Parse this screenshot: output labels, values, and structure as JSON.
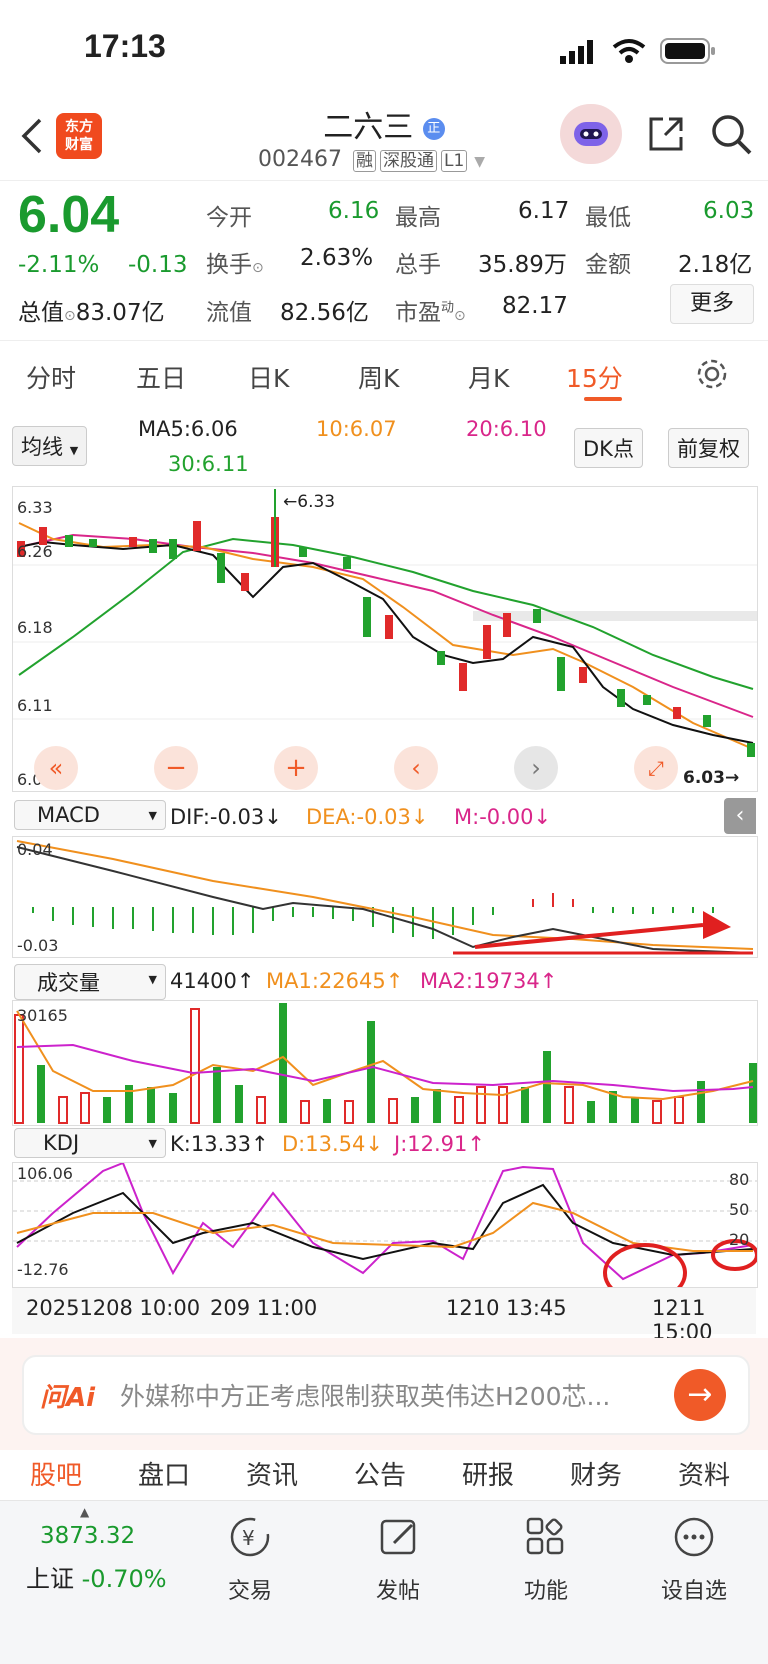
{
  "status": {
    "time": "17:13"
  },
  "header": {
    "logo_text": "东方\n财富",
    "name": "二六三",
    "code": "002467",
    "tags": [
      "融",
      "深股通",
      "L1"
    ]
  },
  "quote": {
    "price": "6.04",
    "pct": "-2.11%",
    "chg": "-0.13",
    "open_label": "今开",
    "open": "6.16",
    "high_label": "最高",
    "high": "6.17",
    "low_label": "最低",
    "low": "6.03",
    "turnover_label": "换手",
    "turnover": "2.63%",
    "vol_label": "总手",
    "vol": "35.89万",
    "amt_label": "金额",
    "amt": "2.18亿",
    "mcap_label": "总值",
    "mcap": "83.07亿",
    "float_label": "流值",
    "float": "82.56亿",
    "pe_label": "市盈",
    "pe_sup": "动",
    "pe": "82.17",
    "more": "更多"
  },
  "tabs": [
    "分时",
    "五日",
    "日K",
    "周K",
    "月K",
    "15分"
  ],
  "ma": {
    "selector": "均线",
    "ma5": "MA5:6.06",
    "ma10": "10:6.07",
    "ma20": "20:6.10",
    "ma30": "30:6.11",
    "dk": "DK点",
    "fq": "前复权"
  },
  "kline": {
    "y_top": "6.33",
    "y2": "6.26",
    "y3": "6.18",
    "y4": "6.11",
    "y_bot": "6.03",
    "hi_mark": "6.33",
    "lo_mark": "6.03"
  },
  "macd": {
    "selector": "MACD",
    "dif": "DIF:-0.03",
    "dea": "DEA:-0.03",
    "m": "M:-0.00",
    "y_top": "0.04",
    "y_bot": "-0.03"
  },
  "volume": {
    "selector": "成交量",
    "vol": "41400",
    "ma1": "MA1:22645",
    "ma2": "MA2:19734",
    "y_top": "30165"
  },
  "kdj": {
    "selector": "KDJ",
    "k": "K:13.33",
    "d": "D:13.54",
    "j": "J:12.91",
    "y_top": "106.06",
    "y_bot": "-12.76",
    "r80": "80",
    "r50": "50",
    "r20": "20"
  },
  "xaxis": [
    "20251208 10:00",
    "209 11:00",
    "1210 13:45",
    "1211 15:00"
  ],
  "ai": {
    "brand": "问Ai",
    "text": "外媒称中方正考虑限制获取英伟达H200芯..."
  },
  "bottom_tabs": [
    "股吧",
    "盘口",
    "资讯",
    "公告",
    "研报",
    "财务",
    "资料"
  ],
  "dock": {
    "index_value": "3873.32",
    "index_name": "上证",
    "index_pct": "-0.70%",
    "items": [
      "交易",
      "发帖",
      "功能",
      "设自选"
    ]
  }
}
